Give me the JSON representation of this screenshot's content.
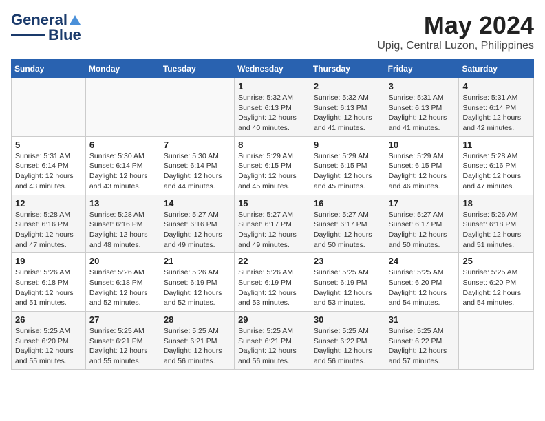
{
  "header": {
    "logo_line1": "General",
    "logo_line2": "Blue",
    "month": "May 2024",
    "location": "Upig, Central Luzon, Philippines"
  },
  "weekdays": [
    "Sunday",
    "Monday",
    "Tuesday",
    "Wednesday",
    "Thursday",
    "Friday",
    "Saturday"
  ],
  "weeks": [
    [
      {
        "day": "",
        "info": ""
      },
      {
        "day": "",
        "info": ""
      },
      {
        "day": "",
        "info": ""
      },
      {
        "day": "1",
        "info": "Sunrise: 5:32 AM\nSunset: 6:13 PM\nDaylight: 12 hours\nand 40 minutes."
      },
      {
        "day": "2",
        "info": "Sunrise: 5:32 AM\nSunset: 6:13 PM\nDaylight: 12 hours\nand 41 minutes."
      },
      {
        "day": "3",
        "info": "Sunrise: 5:31 AM\nSunset: 6:13 PM\nDaylight: 12 hours\nand 41 minutes."
      },
      {
        "day": "4",
        "info": "Sunrise: 5:31 AM\nSunset: 6:14 PM\nDaylight: 12 hours\nand 42 minutes."
      }
    ],
    [
      {
        "day": "5",
        "info": "Sunrise: 5:31 AM\nSunset: 6:14 PM\nDaylight: 12 hours\nand 43 minutes."
      },
      {
        "day": "6",
        "info": "Sunrise: 5:30 AM\nSunset: 6:14 PM\nDaylight: 12 hours\nand 43 minutes."
      },
      {
        "day": "7",
        "info": "Sunrise: 5:30 AM\nSunset: 6:14 PM\nDaylight: 12 hours\nand 44 minutes."
      },
      {
        "day": "8",
        "info": "Sunrise: 5:29 AM\nSunset: 6:15 PM\nDaylight: 12 hours\nand 45 minutes."
      },
      {
        "day": "9",
        "info": "Sunrise: 5:29 AM\nSunset: 6:15 PM\nDaylight: 12 hours\nand 45 minutes."
      },
      {
        "day": "10",
        "info": "Sunrise: 5:29 AM\nSunset: 6:15 PM\nDaylight: 12 hours\nand 46 minutes."
      },
      {
        "day": "11",
        "info": "Sunrise: 5:28 AM\nSunset: 6:16 PM\nDaylight: 12 hours\nand 47 minutes."
      }
    ],
    [
      {
        "day": "12",
        "info": "Sunrise: 5:28 AM\nSunset: 6:16 PM\nDaylight: 12 hours\nand 47 minutes."
      },
      {
        "day": "13",
        "info": "Sunrise: 5:28 AM\nSunset: 6:16 PM\nDaylight: 12 hours\nand 48 minutes."
      },
      {
        "day": "14",
        "info": "Sunrise: 5:27 AM\nSunset: 6:16 PM\nDaylight: 12 hours\nand 49 minutes."
      },
      {
        "day": "15",
        "info": "Sunrise: 5:27 AM\nSunset: 6:17 PM\nDaylight: 12 hours\nand 49 minutes."
      },
      {
        "day": "16",
        "info": "Sunrise: 5:27 AM\nSunset: 6:17 PM\nDaylight: 12 hours\nand 50 minutes."
      },
      {
        "day": "17",
        "info": "Sunrise: 5:27 AM\nSunset: 6:17 PM\nDaylight: 12 hours\nand 50 minutes."
      },
      {
        "day": "18",
        "info": "Sunrise: 5:26 AM\nSunset: 6:18 PM\nDaylight: 12 hours\nand 51 minutes."
      }
    ],
    [
      {
        "day": "19",
        "info": "Sunrise: 5:26 AM\nSunset: 6:18 PM\nDaylight: 12 hours\nand 51 minutes."
      },
      {
        "day": "20",
        "info": "Sunrise: 5:26 AM\nSunset: 6:18 PM\nDaylight: 12 hours\nand 52 minutes."
      },
      {
        "day": "21",
        "info": "Sunrise: 5:26 AM\nSunset: 6:19 PM\nDaylight: 12 hours\nand 52 minutes."
      },
      {
        "day": "22",
        "info": "Sunrise: 5:26 AM\nSunset: 6:19 PM\nDaylight: 12 hours\nand 53 minutes."
      },
      {
        "day": "23",
        "info": "Sunrise: 5:25 AM\nSunset: 6:19 PM\nDaylight: 12 hours\nand 53 minutes."
      },
      {
        "day": "24",
        "info": "Sunrise: 5:25 AM\nSunset: 6:20 PM\nDaylight: 12 hours\nand 54 minutes."
      },
      {
        "day": "25",
        "info": "Sunrise: 5:25 AM\nSunset: 6:20 PM\nDaylight: 12 hours\nand 54 minutes."
      }
    ],
    [
      {
        "day": "26",
        "info": "Sunrise: 5:25 AM\nSunset: 6:20 PM\nDaylight: 12 hours\nand 55 minutes."
      },
      {
        "day": "27",
        "info": "Sunrise: 5:25 AM\nSunset: 6:21 PM\nDaylight: 12 hours\nand 55 minutes."
      },
      {
        "day": "28",
        "info": "Sunrise: 5:25 AM\nSunset: 6:21 PM\nDaylight: 12 hours\nand 56 minutes."
      },
      {
        "day": "29",
        "info": "Sunrise: 5:25 AM\nSunset: 6:21 PM\nDaylight: 12 hours\nand 56 minutes."
      },
      {
        "day": "30",
        "info": "Sunrise: 5:25 AM\nSunset: 6:22 PM\nDaylight: 12 hours\nand 56 minutes."
      },
      {
        "day": "31",
        "info": "Sunrise: 5:25 AM\nSunset: 6:22 PM\nDaylight: 12 hours\nand 57 minutes."
      },
      {
        "day": "",
        "info": ""
      }
    ]
  ]
}
